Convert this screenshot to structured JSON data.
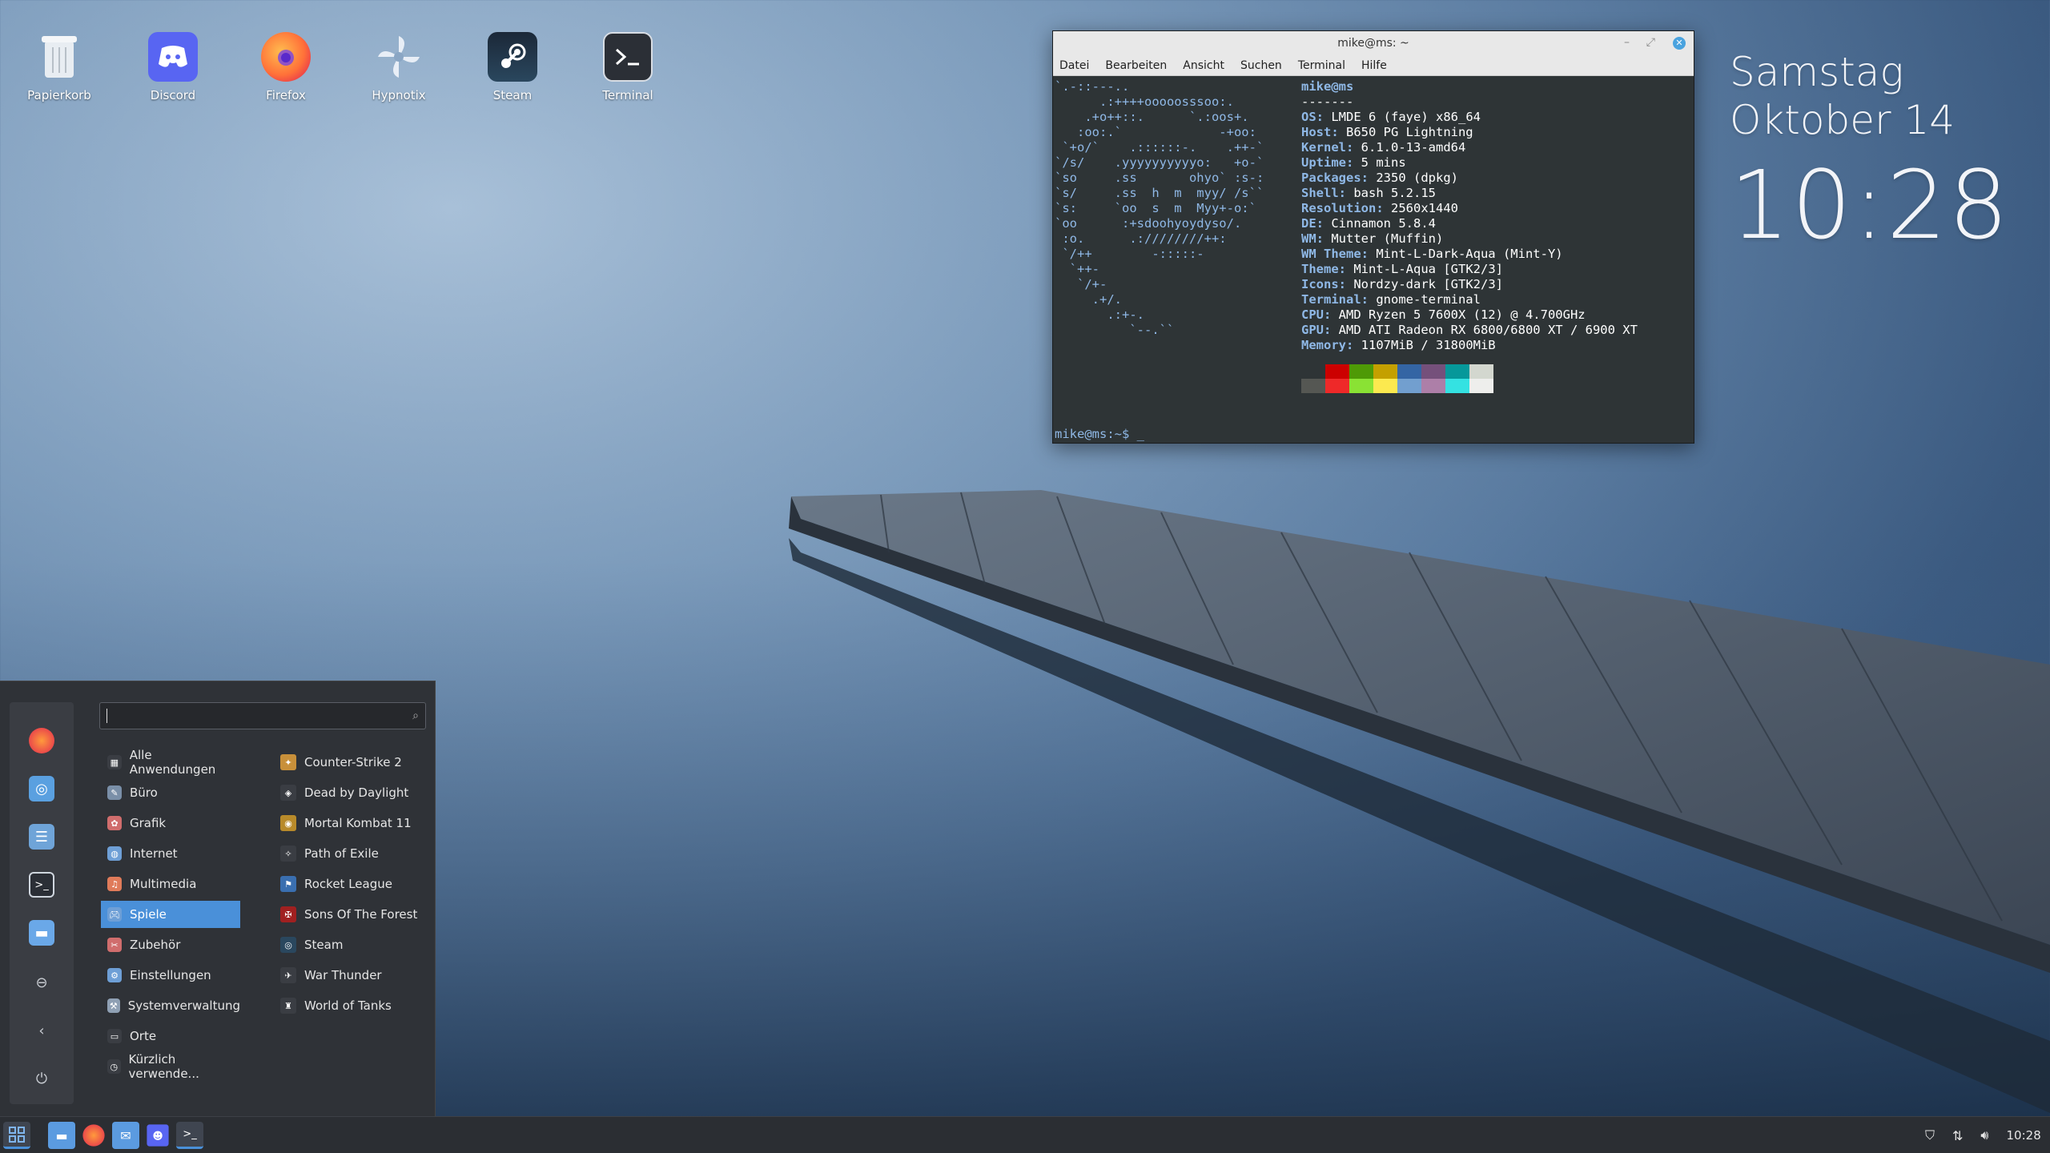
{
  "desktop": {
    "icons": [
      {
        "label": "Papierkorb",
        "icon": "trash-icon"
      },
      {
        "label": "Discord",
        "icon": "discord-icon"
      },
      {
        "label": "Firefox",
        "icon": "firefox-icon"
      },
      {
        "label": "Hypnotix",
        "icon": "hypnotix-icon"
      },
      {
        "label": "Steam",
        "icon": "steam-icon"
      },
      {
        "label": "Terminal",
        "icon": "terminal-icon"
      }
    ]
  },
  "clock": {
    "day": "Samstag",
    "date": "Oktober 14",
    "time": "10:28"
  },
  "terminal": {
    "title": "mike@ms: ~",
    "menu": [
      "Datei",
      "Bearbeiten",
      "Ansicht",
      "Suchen",
      "Terminal",
      "Hilfe"
    ],
    "ascii_art": "`.-::---..\n      .:++++ooooosssoo:.\n    .+o++::.      `.:oos+.\n   :oo:.`             -+oo:\n `+o/`    .::::::-.    .++-`\n`/s/    .yyyyyyyyyyo:   +o-`\n`so     .ss       ohyo` :s-:\n`s/     .ss  h  m  myy/ /s``\n`s:     `oo  s  m  Myy+-o:`\n`oo      :+sdoohyoydyso/.\n :o.      .:////////++:\n `/++        -:::::-\n  `++-\n   `/+-\n     .+/.\n       .:+-.\n          `--.``",
    "user_host": "mike@ms",
    "separator": "-------",
    "info": [
      {
        "key": "OS",
        "value": "LMDE 6 (faye) x86_64"
      },
      {
        "key": "Host",
        "value": "B650 PG Lightning"
      },
      {
        "key": "Kernel",
        "value": "6.1.0-13-amd64"
      },
      {
        "key": "Uptime",
        "value": "5 mins"
      },
      {
        "key": "Packages",
        "value": "2350 (dpkg)"
      },
      {
        "key": "Shell",
        "value": "bash 5.2.15"
      },
      {
        "key": "Resolution",
        "value": "2560x1440"
      },
      {
        "key": "DE",
        "value": "Cinnamon 5.8.4"
      },
      {
        "key": "WM",
        "value": "Mutter (Muffin)"
      },
      {
        "key": "WM Theme",
        "value": "Mint-L-Dark-Aqua (Mint-Y)"
      },
      {
        "key": "Theme",
        "value": "Mint-L-Aqua [GTK2/3]"
      },
      {
        "key": "Icons",
        "value": "Nordzy-dark [GTK2/3]"
      },
      {
        "key": "Terminal",
        "value": "gnome-terminal"
      },
      {
        "key": "CPU",
        "value": "AMD Ryzen 5 7600X (12) @ 4.700GHz"
      },
      {
        "key": "GPU",
        "value": "AMD ATI Radeon RX 6800/6800 XT / 6900 XT"
      },
      {
        "key": "Memory",
        "value": "1107MiB / 31800MiB"
      }
    ],
    "palette_top": [
      "#2e3436",
      "#cc0000",
      "#4e9a06",
      "#c4a000",
      "#3465a4",
      "#75507b",
      "#06989a",
      "#d3d7cf"
    ],
    "palette_bottom": [
      "#555753",
      "#ef2929",
      "#8ae234",
      "#fce94f",
      "#729fcf",
      "#ad7fa8",
      "#34e2e2",
      "#eeeeec"
    ],
    "prompt": "mike@ms:~$ _"
  },
  "start_menu": {
    "search_placeholder": "",
    "categories": [
      {
        "label": "Alle Anwendungen",
        "icon": "grid-icon",
        "selected": false
      },
      {
        "label": "Büro",
        "icon": "office-icon",
        "selected": false
      },
      {
        "label": "Grafik",
        "icon": "graphics-icon",
        "selected": false
      },
      {
        "label": "Internet",
        "icon": "internet-icon",
        "selected": false
      },
      {
        "label": "Multimedia",
        "icon": "multimedia-icon",
        "selected": false
      },
      {
        "label": "Spiele",
        "icon": "games-icon",
        "selected": true
      },
      {
        "label": "Zubehör",
        "icon": "accessories-icon",
        "selected": false
      },
      {
        "label": "Einstellungen",
        "icon": "settings-icon",
        "selected": false
      },
      {
        "label": "Systemverwaltung",
        "icon": "admin-icon",
        "selected": false
      },
      {
        "label": "Orte",
        "icon": "folder-icon",
        "selected": false
      },
      {
        "label": "Kürzlich verwende...",
        "icon": "clock-icon",
        "selected": false
      }
    ],
    "apps": [
      {
        "label": "Counter-Strike 2",
        "icon": "counter-strike-icon"
      },
      {
        "label": "Dead by Daylight",
        "icon": "dead-by-daylight-icon"
      },
      {
        "label": "Mortal Kombat 11",
        "icon": "mortal-kombat-icon"
      },
      {
        "label": "Path of Exile",
        "icon": "path-of-exile-icon"
      },
      {
        "label": "Rocket League",
        "icon": "rocket-league-icon"
      },
      {
        "label": "Sons Of The Forest",
        "icon": "sons-of-the-forest-icon"
      },
      {
        "label": "Steam",
        "icon": "steam-icon"
      },
      {
        "label": "War Thunder",
        "icon": "war-thunder-icon"
      },
      {
        "label": "World of Tanks",
        "icon": "world-of-tanks-icon"
      }
    ]
  },
  "taskbar": {
    "clock": "10:28"
  }
}
